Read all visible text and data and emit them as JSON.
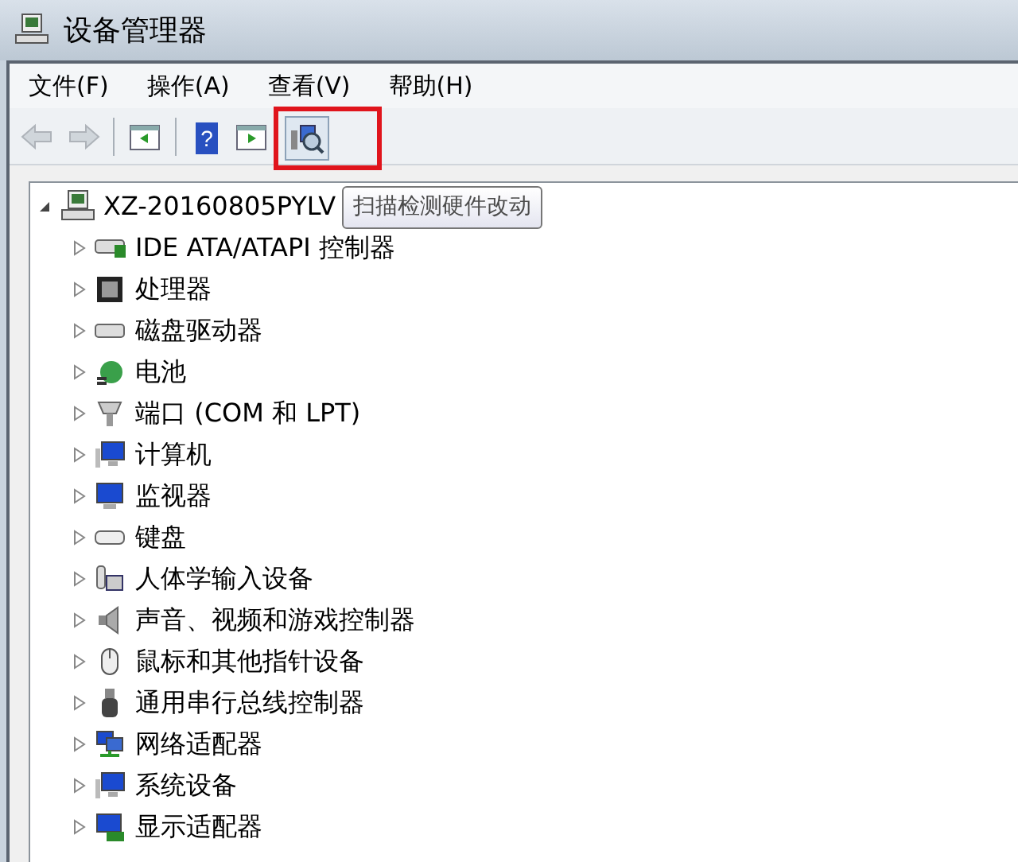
{
  "window": {
    "title": "设备管理器"
  },
  "menu": [
    "文件(F)",
    "操作(A)",
    "查看(V)",
    "帮助(H)"
  ],
  "toolbar": [
    {
      "disabled": true,
      "marked": false
    },
    {
      "disabled": true,
      "marked": false
    },
    {
      "disabled": false,
      "marked": false
    },
    {
      "disabled": false,
      "marked": false,
      "glyph": "?"
    },
    {
      "disabled": false,
      "marked": false
    },
    {
      "disabled": false,
      "marked": true
    }
  ],
  "tooltip": "扫描检测硬件改动",
  "tree": {
    "label": "XZ-20160805PYLV",
    "expanded": true,
    "children": [
      {
        "label": "IDE ATA/ATAPI 控制器",
        "expanded": false
      },
      {
        "label": "处理器",
        "expanded": false
      },
      {
        "label": "磁盘驱动器",
        "expanded": false
      },
      {
        "label": "电池",
        "expanded": false
      },
      {
        "label": "端口 (COM 和 LPT)",
        "expanded": false
      },
      {
        "label": "计算机",
        "expanded": false
      },
      {
        "label": "监视器",
        "expanded": false
      },
      {
        "label": "键盘",
        "expanded": false
      },
      {
        "label": "人体学输入设备",
        "expanded": false
      },
      {
        "label": "声音、视频和游戏控制器",
        "expanded": false
      },
      {
        "label": "鼠标和其他指针设备",
        "expanded": false
      },
      {
        "label": "通用串行总线控制器",
        "expanded": false
      },
      {
        "label": "网络适配器",
        "expanded": false
      },
      {
        "label": "系统设备",
        "expanded": false
      },
      {
        "label": "显示适配器",
        "expanded": false
      }
    ]
  }
}
